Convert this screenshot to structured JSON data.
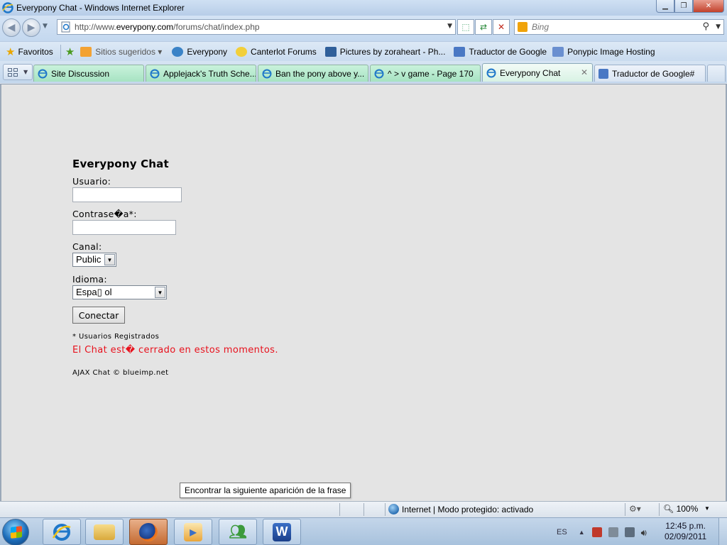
{
  "window": {
    "title": "Everypony Chat - Windows Internet Explorer",
    "min_glyph": "▁",
    "max_glyph": "❐",
    "close_glyph": "✕"
  },
  "address_bar": {
    "url_prefix": "http://www.",
    "url_domain": "everypony.com",
    "url_path": "/forums/chat/index.php",
    "search_placeholder": "Bing"
  },
  "favorites": {
    "label": "Favoritos",
    "items": [
      {
        "label": "Sitios sugeridos ▾",
        "icon": "suggested-sites-icon",
        "color": "#f3a233"
      },
      {
        "label": "Everypony",
        "icon": "ie-page-icon",
        "color": "#3b83c7"
      },
      {
        "label": "Canterlot Forums",
        "icon": "sun-icon",
        "color": "#f2cf3b"
      },
      {
        "label": "Pictures by zoraheart - Ph...",
        "icon": "photobucket-icon",
        "color": "#2f5f9a"
      },
      {
        "label": "Traductor de Google",
        "icon": "translate-icon",
        "color": "#4a78c4"
      },
      {
        "label": "Ponypic Image Hosting",
        "icon": "ponypic-icon",
        "color": "#6a8fd0"
      }
    ]
  },
  "tabs": [
    {
      "label": "Site Discussion"
    },
    {
      "label": "Applejack's Truth Sche..."
    },
    {
      "label": "Ban the pony above y..."
    },
    {
      "label": "^ > v game - Page 170"
    },
    {
      "label": "Everypony Chat"
    },
    {
      "label": "Traductor de Google#"
    }
  ],
  "login": {
    "heading": "Everypony Chat",
    "user_label": "Usuario:",
    "password_label": "Contrase�a*:",
    "channel_label": "Canal:",
    "channel_value": "Public",
    "language_label": "Idioma:",
    "language_value": "Espa▯ ol",
    "connect_button": "Conectar",
    "note": "* Usuarios Registrados",
    "error": "El Chat est� cerrado en estos momentos.",
    "error_color": "#e8111d",
    "copyright": "AJAX Chat © blueimp.net"
  },
  "tooltip": "Encontrar la siguiente aparición de la frase",
  "status_bar": {
    "zone": "Internet | Modo protegido: activado",
    "zoom": "100%"
  },
  "taskbar": {
    "language": "ES",
    "time": "12:45 p.m.",
    "date": "02/09/2011"
  }
}
